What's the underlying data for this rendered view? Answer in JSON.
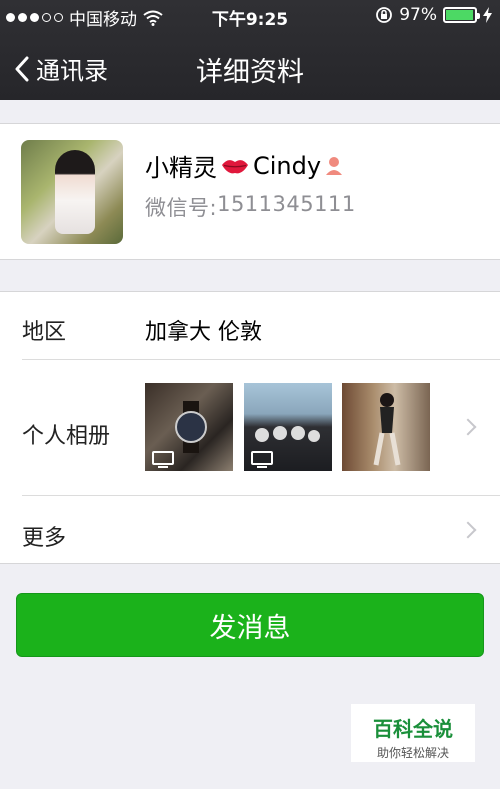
{
  "status_bar": {
    "carrier": "中国移动",
    "time": "下午9:25",
    "battery": "97%",
    "battery_level": 0.97,
    "icons": [
      "signal-dots-icon",
      "wifi-icon",
      "rotation-lock-icon",
      "battery-icon",
      "charging-icon"
    ]
  },
  "nav": {
    "back_label": "通讯录",
    "title": "详细资料"
  },
  "profile": {
    "name_prefix": "小精灵",
    "name_suffix": "Cindy",
    "wechat_id_label": "微信号:",
    "wechat_id": "1511345111"
  },
  "details": {
    "region_label": "地区",
    "region_value": "加拿大 伦敦",
    "album_label": "个人相册",
    "more_label": "更多"
  },
  "actions": {
    "send_message": "发消息"
  },
  "watermark": {
    "title": "百科全说",
    "subtitle": "助你轻松解决"
  },
  "colors": {
    "nav_bg": "#2b2b2f",
    "accent_green": "#1bb21b",
    "page_bg": "#efeff4"
  }
}
